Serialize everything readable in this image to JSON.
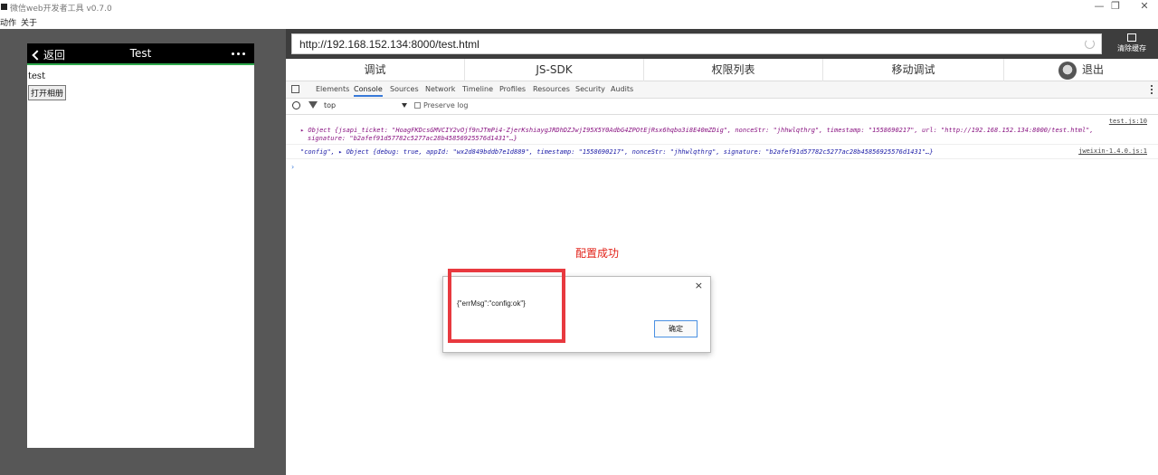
{
  "window": {
    "title": "微信web开发者工具 v0.7.0",
    "minimize": "—",
    "restore": "❐",
    "close": "✕"
  },
  "menu": {
    "items": [
      "动作",
      "关于"
    ]
  },
  "phone": {
    "back_label": "返回",
    "title": "Test",
    "body_text": "test",
    "button_label": "打开相册"
  },
  "browser": {
    "url": "http://192.168.152.134:8000/test.html",
    "clear_cache_label": "清除缓存"
  },
  "tabs": [
    "调试",
    "JS-SDK",
    "权限列表",
    "移动调试"
  ],
  "logout_label": "退出",
  "devtools": {
    "tabs": [
      "Elements",
      "Console",
      "Sources",
      "Network",
      "Timeline",
      "Profiles",
      "Resources",
      "Security",
      "Audits"
    ],
    "active_tab": "Console",
    "context": "top",
    "preserve_log": "Preserve log"
  },
  "console": {
    "line1_source": "test.js:10",
    "line1_text": "▸ Object {jsapi_ticket: \"HoagFKDcsGMVCIY2vOjf9nJTmPi4-ZjerKshiaygJRDhDZJwjI95X5Y0AdbG4ZPOtEjRsx6hqbo3i8E40mZDig\", nonceStr: \"jhhwlqthrg\", timestamp: \"1558690217\", url: \"http://192.168.152.134:8000/test.html\",",
    "line1_text2": "signature: \"b2afef91d57782c5277ac28b45856925576d1431\"…}",
    "line2_source": "jweixin-1.4.0.js:1",
    "line2_text": "\"config\", ▸ Object {debug: true, appId: \"wx2d849bddb7e1d889\", timestamp: \"1558690217\", nonceStr: \"jhhwlqthrg\", signature: \"b2afef91d57782c5277ac28b45856925576d1431\"…}",
    "prompt": "›"
  },
  "annotation": "配置成功",
  "dialog": {
    "message": "{\"errMsg\":\"config:ok\"}",
    "ok_label": "确定",
    "close": "×"
  }
}
